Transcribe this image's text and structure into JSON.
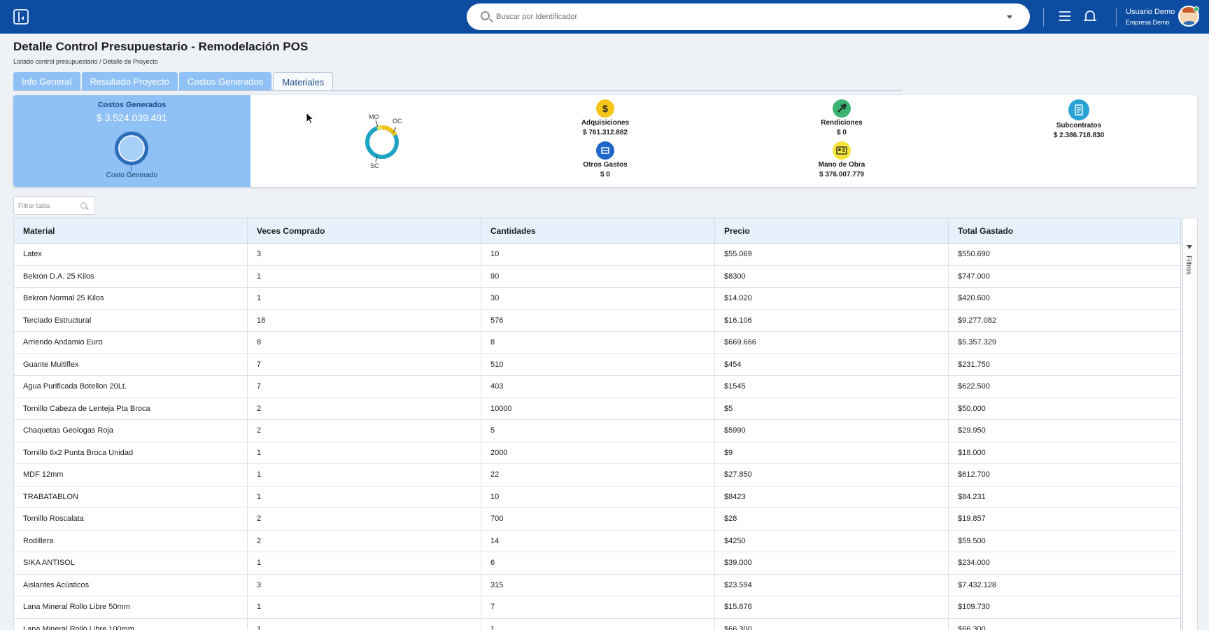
{
  "header": {
    "search_placeholder": "Buscar por Identificador",
    "user_name": "Usuario Demo",
    "user_company": "Empresa Demo",
    "brand_color": "#0d4da1"
  },
  "page": {
    "title": "Detalle Control Presupuestario - Remodelación POS",
    "breadcrumb": "Listado control presupuestario / Detalle de Proyecto"
  },
  "tabs": [
    {
      "label": "Info General",
      "active": false
    },
    {
      "label": "Resultado Proyecto",
      "active": false
    },
    {
      "label": "Costos Generados",
      "active": false
    },
    {
      "label": "Materiales",
      "active": true
    }
  ],
  "summary": {
    "left_title": "Costos Generados",
    "left_value": "$ 3.524.039.491",
    "left_chart_label": "Costo Generado",
    "donut_labels": {
      "mo": "MO",
      "oc": "OC",
      "sc": "SC"
    },
    "metrics": [
      {
        "label": "Adquisiciones",
        "value": "$ 761.312.882",
        "icon": "dollar-icon",
        "color": "#f5c518"
      },
      {
        "label": "Rendiciones",
        "value": "$ 0",
        "icon": "tools-icon",
        "color": "#3cb371"
      },
      {
        "label": "Subcontratos",
        "value": "$ 2.386.718.830",
        "icon": "document-icon",
        "color": "#29a3d6"
      },
      {
        "label": "Otros Gastos",
        "value": "$ 0",
        "icon": "box-icon",
        "color": "#1e66c9"
      },
      {
        "label": "Mano de Obra",
        "value": "$ 376.007.779",
        "icon": "id-card-icon",
        "color": "#f5e43a"
      }
    ]
  },
  "filter": {
    "placeholder": "Filtrar tabla"
  },
  "table": {
    "columns": [
      "Material",
      "Veces Comprado",
      "Cantidades",
      "Precio",
      "Total Gastado"
    ],
    "rows": [
      [
        "Latex",
        "3",
        "10",
        "$55.069",
        "$550.690"
      ],
      [
        "Bekron D.A. 25 Kilos",
        "1",
        "90",
        "$8300",
        "$747.000"
      ],
      [
        "Bekron Normal 25 Kilos",
        "1",
        "30",
        "$14.020",
        "$420.600"
      ],
      [
        "Terciado Estructural",
        "18",
        "576",
        "$16.106",
        "$9.277.082"
      ],
      [
        "Arriendo Andamio Euro",
        "8",
        "8",
        "$669.666",
        "$5.357.329"
      ],
      [
        "Guante Multiflex",
        "7",
        "510",
        "$454",
        "$231.750"
      ],
      [
        "Agua Purificada Botellon 20Lt.",
        "7",
        "403",
        "$1545",
        "$622.500"
      ],
      [
        "Tornillo Cabeza de Lenteja Pta Broca",
        "2",
        "10000",
        "$5",
        "$50.000"
      ],
      [
        "Chaquetas Geologas Roja",
        "2",
        "5",
        "$5990",
        "$29.950"
      ],
      [
        "Tornillo 6x2 Punta Broca Unidad",
        "1",
        "2000",
        "$9",
        "$18.000"
      ],
      [
        "MDF 12mm",
        "1",
        "22",
        "$27.850",
        "$612.700"
      ],
      [
        "TRABATABLON",
        "1",
        "10",
        "$8423",
        "$84.231"
      ],
      [
        "Tornillo Roscalata",
        "2",
        "700",
        "$28",
        "$19.857"
      ],
      [
        "Rodillera",
        "2",
        "14",
        "$4250",
        "$59.500"
      ],
      [
        "SIKA ANTISOL",
        "1",
        "6",
        "$39.000",
        "$234.000"
      ],
      [
        "Aislantes Acústicos",
        "3",
        "315",
        "$23.594",
        "$7.432.128"
      ],
      [
        "Lana Mineral Rollo Libre 50mm",
        "1",
        "7",
        "$15.676",
        "$109.730"
      ],
      [
        "Lana Mineral Rollo Libre 100mm",
        "1",
        "1",
        "$66.300",
        "$66.300"
      ]
    ]
  },
  "side_panel": {
    "label": "Filtros"
  }
}
